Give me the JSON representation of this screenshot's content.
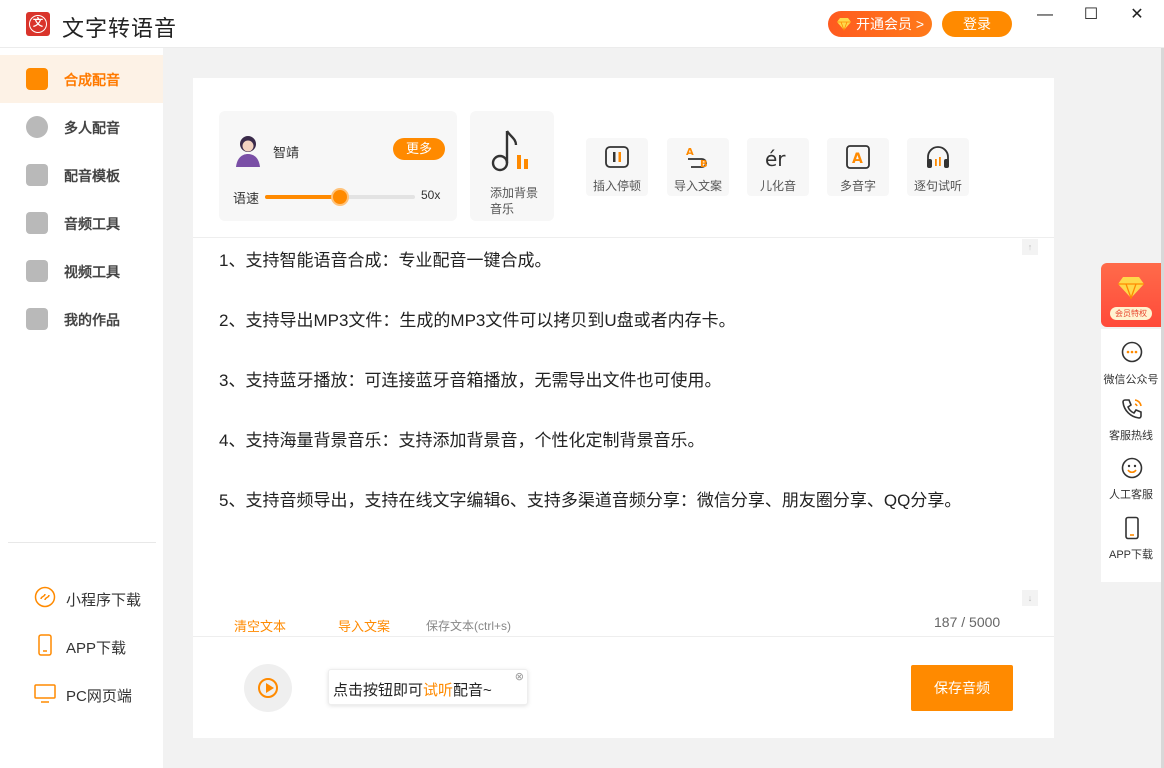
{
  "app": {
    "title": "文字转语音",
    "logo_char": "文"
  },
  "header": {
    "vip_label": "开通会员",
    "vip_chevron": ">",
    "login_label": "登录",
    "minimize": "—",
    "maximize": "☐",
    "close": "✕"
  },
  "sidebar": {
    "items": [
      {
        "label": "合成配音",
        "icon": "microphone-icon",
        "active": true
      },
      {
        "label": "多人配音",
        "icon": "users-icon"
      },
      {
        "label": "配音模板",
        "icon": "template-icon"
      },
      {
        "label": "音频工具",
        "icon": "music-note-icon"
      },
      {
        "label": "视频工具",
        "icon": "video-icon"
      },
      {
        "label": "我的作品",
        "icon": "folder-icon"
      }
    ],
    "links": [
      {
        "label": "小程序下载",
        "icon": "miniprogram-icon"
      },
      {
        "label": "APP下载",
        "icon": "phone-icon"
      },
      {
        "label": "PC网页端",
        "icon": "monitor-icon"
      }
    ]
  },
  "voice": {
    "name": "智靖",
    "more_label": "更多",
    "speed_label": "语速",
    "speed_value": "50x",
    "speed_percent": 50
  },
  "bgm": {
    "label": "添加背景音乐"
  },
  "tools": [
    {
      "label": "插入停顿",
      "icon": "pause-insert-icon"
    },
    {
      "label": "导入文案",
      "icon": "import-text-icon"
    },
    {
      "label": "儿化音",
      "icon": "er-icon",
      "glyph": "ér"
    },
    {
      "label": "多音字",
      "icon": "polyphone-icon",
      "glyph": "A"
    },
    {
      "label": "逐句试听",
      "icon": "headphones-icon"
    }
  ],
  "editor": {
    "paragraphs": [
      "  1、支持智能语音合成：专业配音一键合成。",
      "   2、支持导出MP3文件：生成的MP3文件可以拷贝到U盘或者内存卡。",
      "   3、支持蓝牙播放：可连接蓝牙音箱播放，无需导出文件也可使用。",
      "   4、支持海量背景音乐：支持添加背景音，个性化定制背景音乐。",
      "   5、支持音频导出，支持在线文字编辑6、支持多渠道音频分享：微信分享、朋友圈分享、QQ分享。"
    ],
    "scroll_up": "↑",
    "scroll_down": "↓"
  },
  "actions": {
    "clear": "清空文本",
    "import": "导入文案",
    "save_text": "保存文本(ctrl+s)",
    "counter": "187 / 5000"
  },
  "player": {
    "tip_prefix": "点击按钮即可",
    "tip_highlight": "试听",
    "tip_suffix": "配音~",
    "tip_close": "⊗",
    "save_audio": "保存音频"
  },
  "float_bar": {
    "vip_tag": "会员特权",
    "items": [
      {
        "label": "微信公众号",
        "icon": "wechat-chat-icon"
      },
      {
        "label": "客服热线",
        "icon": "phone-call-icon"
      },
      {
        "label": "人工客服",
        "icon": "service-face-icon"
      },
      {
        "label": "APP下载",
        "icon": "mobile-icon"
      }
    ]
  },
  "colors": {
    "accent": "#ff8a00",
    "vip": "#ff5a1f",
    "logo": "#d9342b"
  }
}
